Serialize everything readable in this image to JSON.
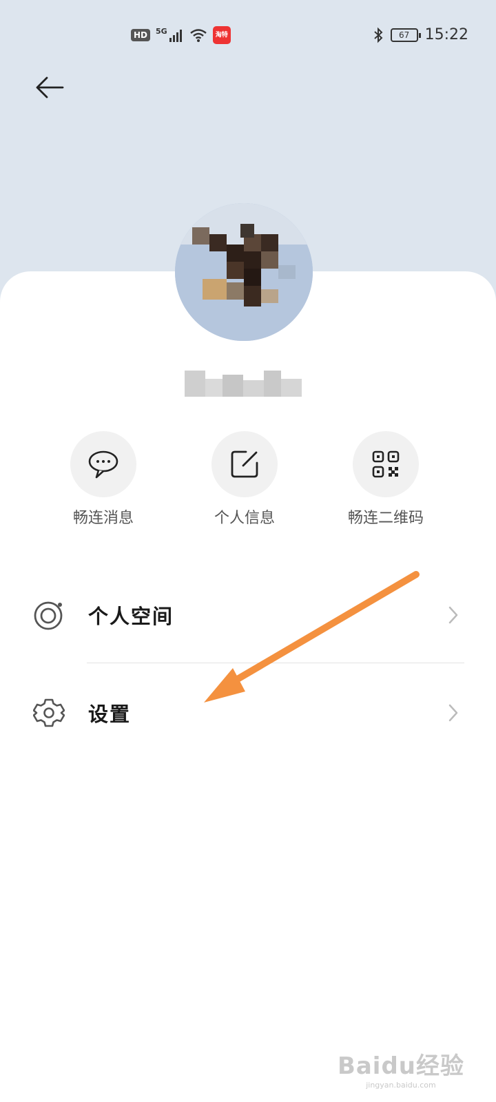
{
  "status_bar": {
    "hd": "HD",
    "network": "5G",
    "app_badge": "淘特",
    "battery": "67",
    "time": "15:22"
  },
  "header": {
    "back_icon": "arrow-left-icon"
  },
  "profile": {
    "avatar_icon": "avatar-eagle-image"
  },
  "quick_actions": [
    {
      "label": "畅连消息",
      "icon": "chat-bubble-icon"
    },
    {
      "label": "个人信息",
      "icon": "edit-square-icon"
    },
    {
      "label": "畅连二维码",
      "icon": "qr-code-icon"
    }
  ],
  "menu": [
    {
      "label": "个人空间",
      "icon": "personal-space-icon"
    },
    {
      "label": "设置",
      "icon": "gear-icon"
    }
  ],
  "annotation": {
    "arrow_color": "#f4913f"
  },
  "watermark": {
    "brand": "Baidu经验",
    "url": "jingyan.baidu.com"
  },
  "colors": {
    "background_top": "#dde5ee",
    "card": "#ffffff",
    "arrow": "#f4913f"
  }
}
